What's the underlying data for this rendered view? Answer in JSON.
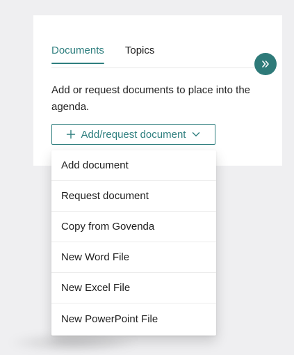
{
  "tabs": [
    {
      "label": "Documents"
    },
    {
      "label": "Topics"
    }
  ],
  "panel": {
    "description": "Add or request documents to place into the agenda.",
    "add_button_label": "Add/request document"
  },
  "dropdown": {
    "items": [
      {
        "label": "Add document"
      },
      {
        "label": "Request document"
      },
      {
        "label": "Copy from Govenda"
      },
      {
        "label": "New Word File"
      },
      {
        "label": "New Excel File"
      },
      {
        "label": "New PowerPoint File"
      }
    ]
  },
  "icons": {
    "expand": "double-chevron-right-icon",
    "plus": "plus-icon",
    "chevron": "chevron-down-icon"
  },
  "colors": {
    "accent": "#2f7f7f",
    "background": "#efeff1",
    "panel": "#ffffff"
  }
}
